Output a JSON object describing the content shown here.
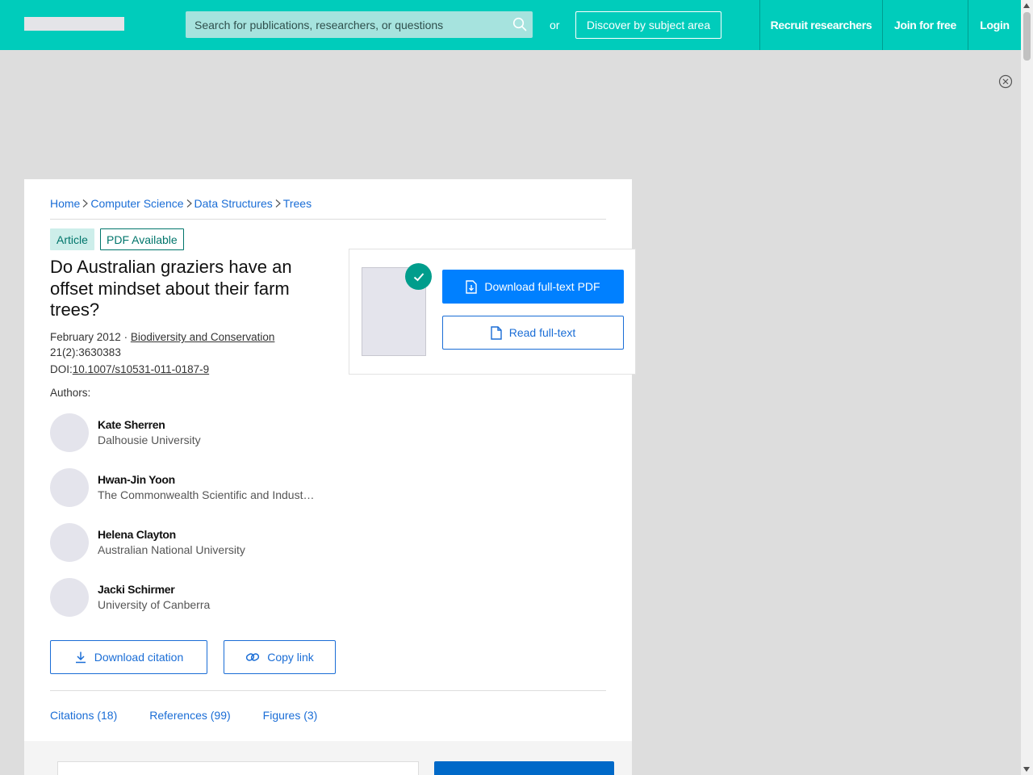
{
  "header": {
    "search_placeholder": "Search for publications, researchers, or questions",
    "or_text": "or",
    "discover_label": "Discover by subject area",
    "recruit_label": "Recruit researchers",
    "join_label": "Join for free",
    "login_label": "Login"
  },
  "breadcrumb": [
    {
      "label": "Home"
    },
    {
      "label": "Computer Science"
    },
    {
      "label": "Data Structures"
    },
    {
      "label": "Trees"
    }
  ],
  "article": {
    "type_badge": "Article",
    "pdf_badge": "PDF Available",
    "title": "Do Australian graziers have an offset mindset about their farm trees?",
    "date": "February 2012",
    "meta_sep": " · ",
    "journal": "Biodiversity and Conservation",
    "volume": "21(2):3630383",
    "doi_label": "DOI:",
    "doi": "10.1007/s10531-011-0187-9",
    "authors_label": "Authors:"
  },
  "authors": [
    {
      "name": "Kate Sherren",
      "institution": "Dalhousie University"
    },
    {
      "name": "Hwan-Jin Yoon",
      "institution": "The Commonwealth Scientific and Industrial Research Organisation"
    },
    {
      "name": "Helena Clayton",
      "institution": "Australian National University"
    },
    {
      "name": "Jacki Schirmer",
      "institution": "University of Canberra"
    }
  ],
  "actions": {
    "download_citation": "Download citation",
    "copy_link": "Copy link"
  },
  "tabs": [
    {
      "label": "Citations (18)"
    },
    {
      "label": "References (99)"
    },
    {
      "label": "Figures (3)"
    }
  ],
  "download_panel": {
    "download_pdf": "Download full-text PDF",
    "read_fulltext": "Read full-text"
  },
  "colors": {
    "brand_teal": "#00ccbb",
    "link_blue": "#1a6dd6",
    "primary_blue": "#0080ff",
    "badge_teal": "#00756b"
  }
}
